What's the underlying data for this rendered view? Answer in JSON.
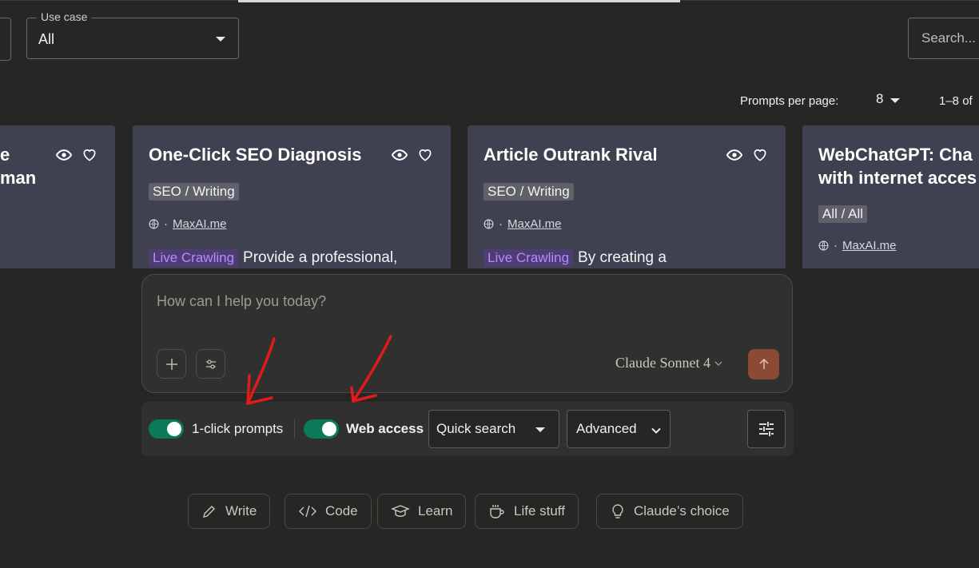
{
  "filters": {
    "use_case_label": "Use case",
    "use_case_value": "All",
    "search_placeholder": "Search..."
  },
  "pagination": {
    "per_page_label": "Prompts per page:",
    "per_page_value": "8",
    "range": "1–8 of"
  },
  "cards": [
    {
      "title": "e\nman",
      "tag": "",
      "source": "",
      "live": "",
      "desc": ""
    },
    {
      "title": "One-Click SEO Diagnosis",
      "tag": "SEO / Writing",
      "source": "MaxAI.me",
      "live": "Live Crawling",
      "desc": "Provide a professional,"
    },
    {
      "title": "Article Outrank Rival",
      "tag": "SEO / Writing",
      "source": "MaxAI.me",
      "live": "Live Crawling",
      "desc": "By creating a"
    },
    {
      "title": "WebChatGPT: Cha\nwith internet acces",
      "tag": "All / All",
      "source": "MaxAI.me",
      "live": "",
      "desc": ""
    }
  ],
  "composer": {
    "placeholder": "How can I help you today?",
    "model": "Claude Sonnet 4"
  },
  "toolbar": {
    "prompts_toggle_label": "1-click prompts",
    "web_access_label": "Web access",
    "search_mode": "Quick search",
    "advanced": "Advanced"
  },
  "chips": [
    {
      "label": "Write",
      "icon": "pencil-icon"
    },
    {
      "label": "Code",
      "icon": "code-icon"
    },
    {
      "label": "Learn",
      "icon": "graduation-cap-icon"
    },
    {
      "label": "Life stuff",
      "icon": "coffee-cup-icon"
    },
    {
      "label": "Claude’s choice",
      "icon": "lightbulb-icon"
    }
  ],
  "colors": {
    "background": "#262624",
    "card": "#3f4150",
    "toggle_on": "#0a7a58",
    "send_button": "#8a4a34",
    "live_badge": "#b38cff",
    "annotation_arrow": "#e01b1b"
  }
}
